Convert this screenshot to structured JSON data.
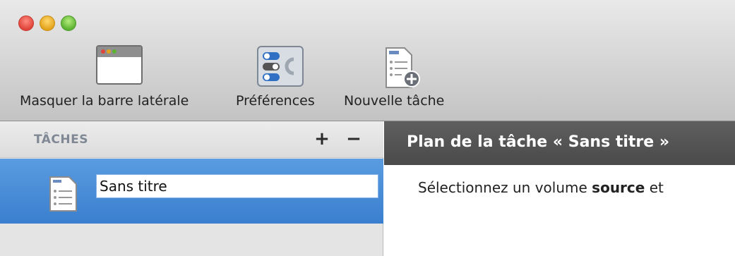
{
  "toolbar": {
    "hide_sidebar_label": "Masquer la barre latérale",
    "preferences_label": "Préférences",
    "new_task_label": "Nouvelle tâche"
  },
  "sidebar": {
    "section_title": "TÂCHES",
    "add_label": "+",
    "remove_label": "−",
    "tasks": [
      {
        "name": "Sans titre",
        "selected": true
      }
    ]
  },
  "content": {
    "title": "Plan de la tâche « Sans titre »",
    "instruction_prefix": "Sélectionnez un volume ",
    "instruction_bold": "source",
    "instruction_suffix": " et"
  },
  "colors": {
    "selection": "#3a7fcf",
    "content_header": "#4a4a4a",
    "sidebar_bg": "#e4e4e4"
  },
  "icons": [
    "window-sidebar-icon",
    "preferences-toggle-icon",
    "new-task-document-icon",
    "task-document-icon"
  ]
}
